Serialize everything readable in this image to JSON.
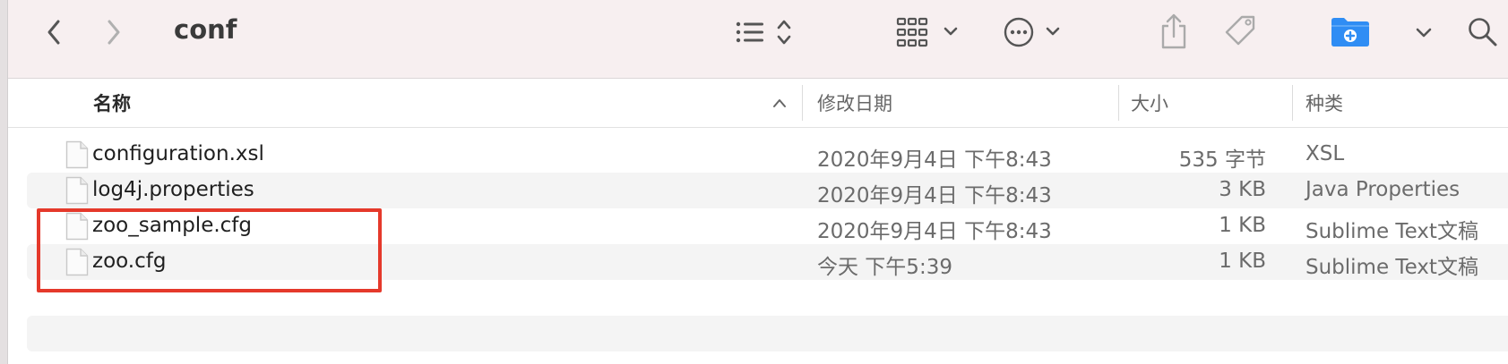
{
  "window": {
    "title": "conf"
  },
  "toolbar": {
    "back": "chevron-left-icon",
    "forward": "chevron-right-icon",
    "view_mode": "list-view-icon",
    "group": "grid-group-icon",
    "action": "more-actions-icon",
    "share": "share-icon",
    "tag": "tag-icon",
    "new_folder": "new-folder-icon",
    "search": "search-icon",
    "accent": "#2f8df4"
  },
  "columns": {
    "name": "名称",
    "date": "修改日期",
    "size": "大小",
    "kind": "种类"
  },
  "files": [
    {
      "name": "configuration.xsl",
      "date": "2020年9月4日 下午8:43",
      "size": "535 字节",
      "kind": "XSL"
    },
    {
      "name": "log4j.properties",
      "date": "2020年9月4日 下午8:43",
      "size": "3 KB",
      "kind": "Java Properties"
    },
    {
      "name": "zoo_sample.cfg",
      "date": "2020年9月4日 下午8:43",
      "size": "1 KB",
      "kind": "Sublime Text文稿"
    },
    {
      "name": "zoo.cfg",
      "date": "今天 下午5:39",
      "size": "1 KB",
      "kind": "Sublime Text文稿"
    }
  ],
  "annotation": {
    "color": "#e5392b"
  }
}
